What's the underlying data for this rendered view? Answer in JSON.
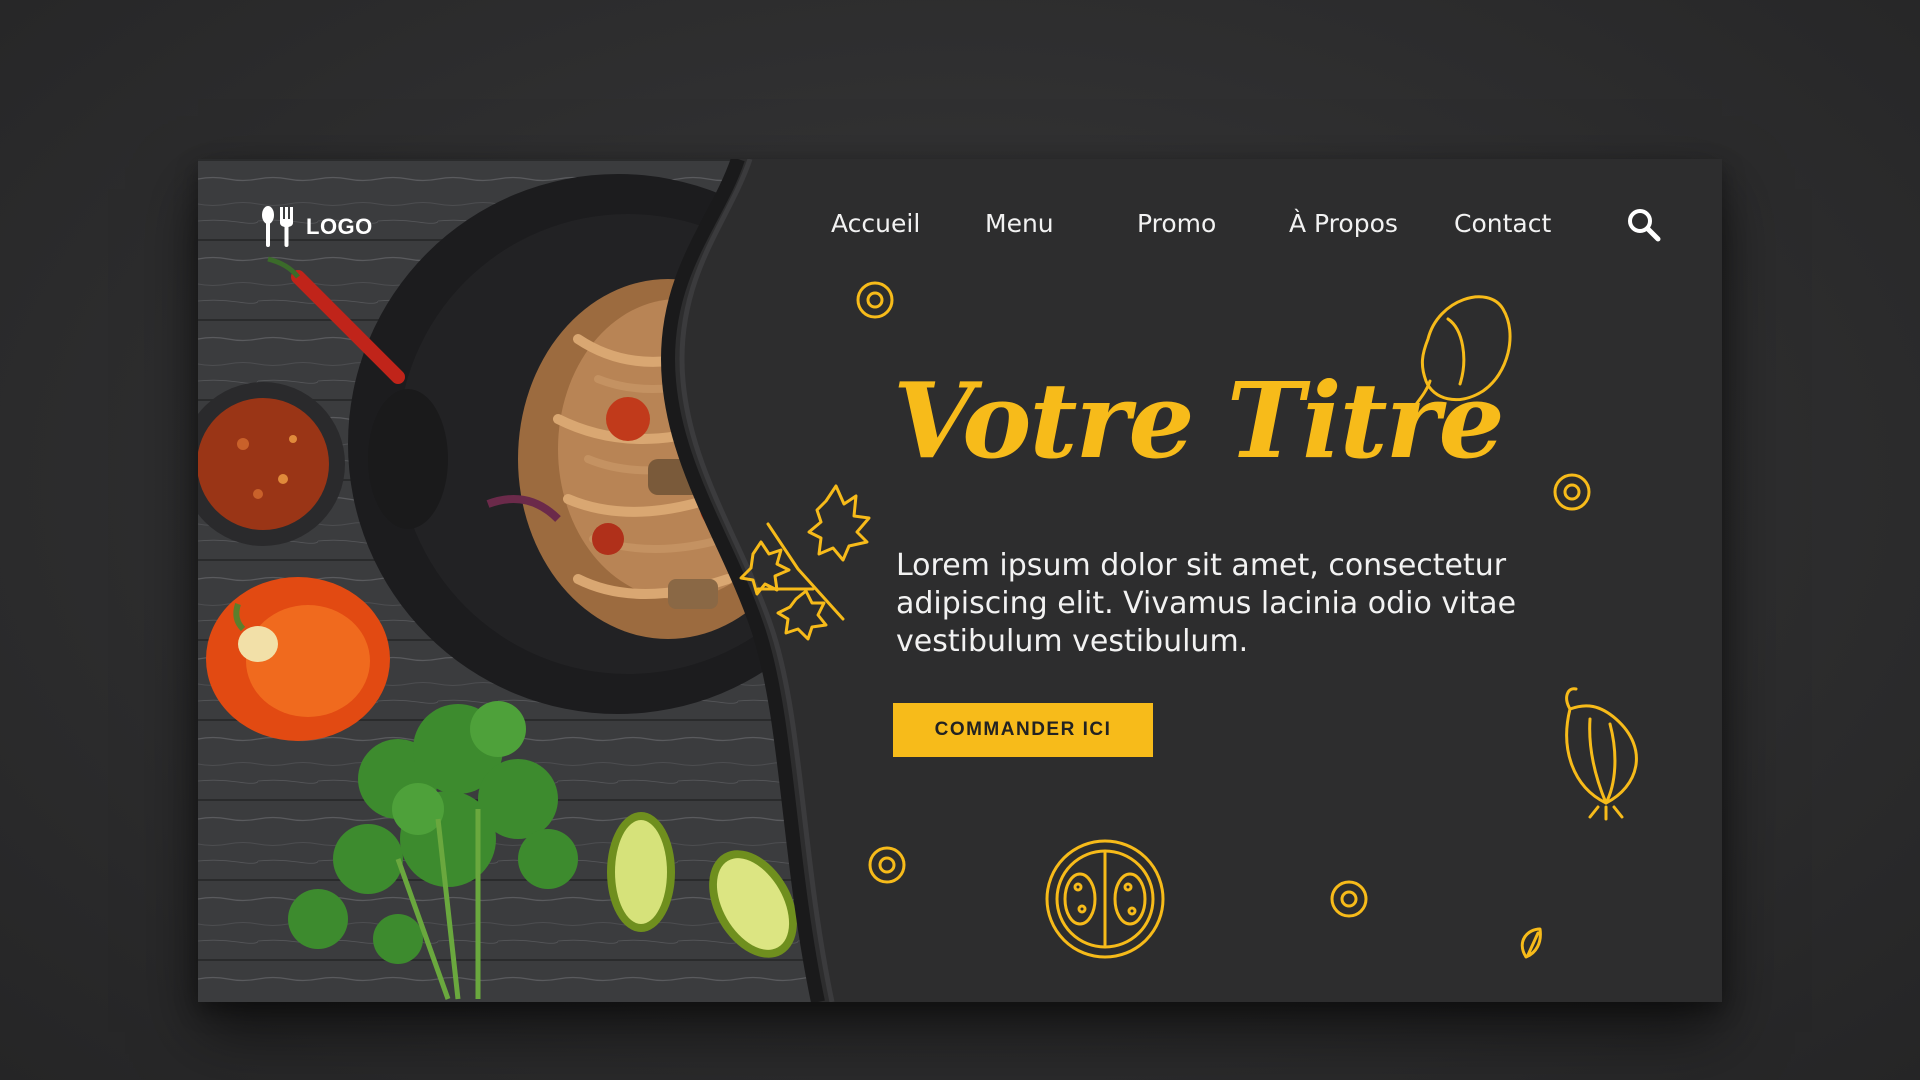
{
  "header": {
    "logo_text": "LOGO",
    "nav": [
      {
        "label": "Accueil"
      },
      {
        "label": "Menu"
      },
      {
        "label": "Promo"
      },
      {
        "label": "À Propos"
      },
      {
        "label": "Contact"
      }
    ],
    "search_icon": "search-icon"
  },
  "hero": {
    "title": "Votre Titre",
    "text": "Lorem ipsum dolor sit amet, consectetur adipiscing elit. Vivamus lacinia odio vitae vestibulum vestibulum.",
    "cta_label": "COMMANDER ICI"
  },
  "colors": {
    "accent": "#f7bb1a",
    "panel": "#2d2d2e",
    "background": "#2e2e2f",
    "text": "#f2f2f2"
  },
  "icons": [
    "fork-spoon-icon",
    "search-icon",
    "parsley-doodle-icon",
    "pepper-doodle-icon",
    "garlic-doodle-icon",
    "tomato-slice-doodle-icon",
    "seed-doodle-icon"
  ]
}
